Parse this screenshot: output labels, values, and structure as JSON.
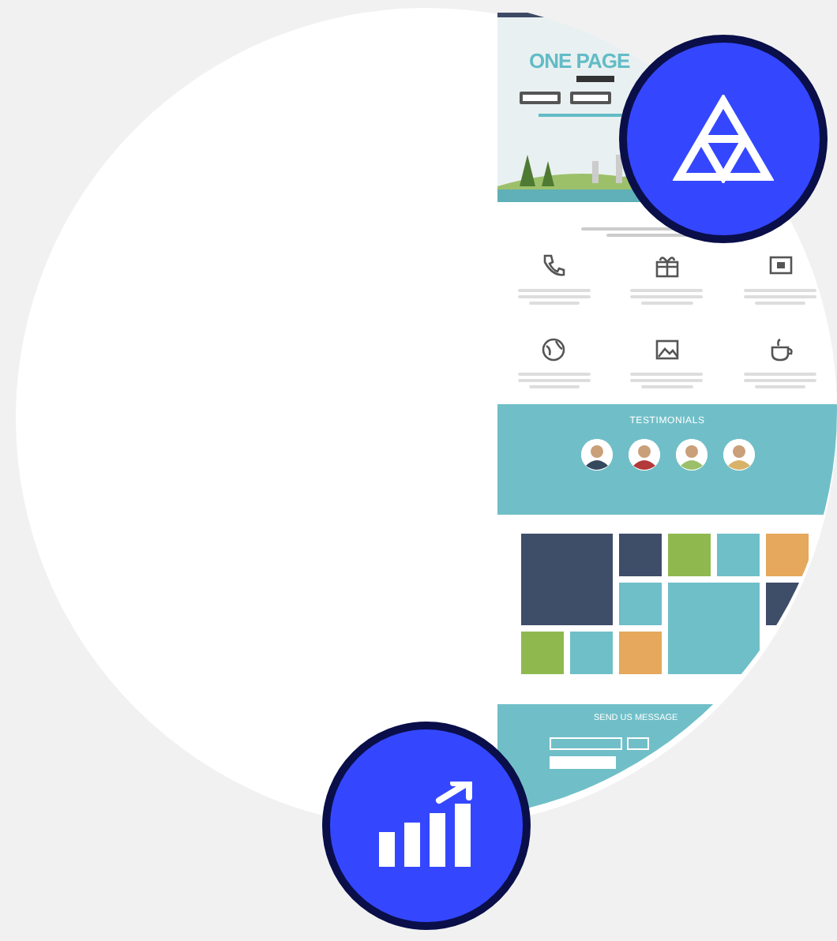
{
  "mockup": {
    "hero": {
      "title": "ONE PAGE"
    },
    "features": [
      {
        "kind": "phone"
      },
      {
        "kind": "gift"
      },
      {
        "kind": "monitor"
      },
      {
        "kind": "globe"
      },
      {
        "kind": "picture"
      },
      {
        "kind": "cup"
      }
    ],
    "testimonials": {
      "title": "TESTIMONIALS"
    },
    "contact": {
      "title": "SEND US MESSAGE"
    }
  },
  "badges": [
    {
      "kind": "triangle"
    },
    {
      "kind": "chart"
    }
  ]
}
